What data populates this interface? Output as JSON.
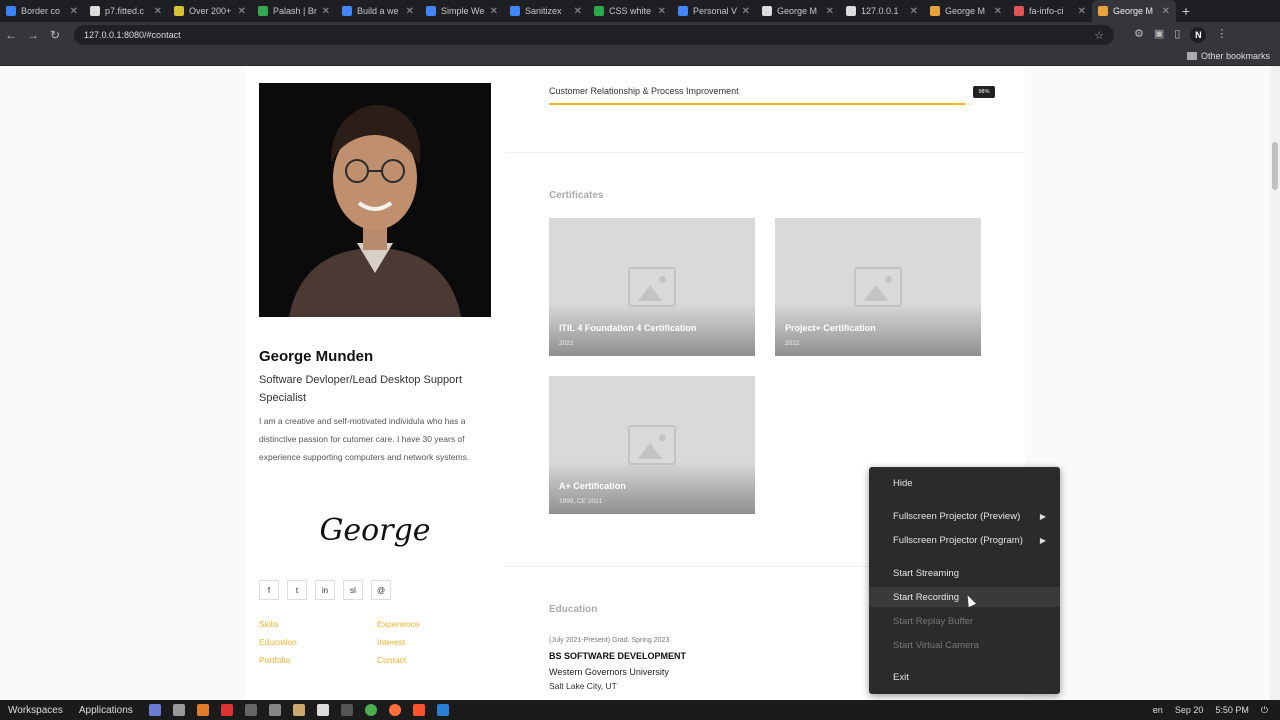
{
  "browser": {
    "tabs": [
      {
        "title": "Border co",
        "color": "#3b82f6"
      },
      {
        "title": "p7.fitted.c",
        "color": "#dddddd"
      },
      {
        "title": "Over 200+",
        "color": "#d4c13a"
      },
      {
        "title": "Palash | Br",
        "color": "#34a853"
      },
      {
        "title": "Build a we",
        "color": "#4285f4"
      },
      {
        "title": "Simple We",
        "color": "#4285f4"
      },
      {
        "title": "Sanitizex",
        "color": "#4285f4"
      },
      {
        "title": "CSS white",
        "color": "#2ba84a"
      },
      {
        "title": "Personal V",
        "color": "#4285f4"
      },
      {
        "title": "George M",
        "color": "#dddddd"
      },
      {
        "title": "127.0.0.1",
        "color": "#dddddd"
      },
      {
        "title": "George M",
        "color": "#e8a33d"
      },
      {
        "title": "fa-info-ci",
        "color": "#e25555"
      },
      {
        "title": "George M",
        "color": "#e8a33d",
        "active": true
      }
    ],
    "new_tab": "+",
    "url": "127.0.0.1:8080/#contact",
    "profile_initial": "N",
    "other_bookmarks": "Other bookmarks"
  },
  "profile": {
    "name": "George Munden",
    "role": "Software Devloper/Lead Desktop Support Specialist",
    "bio": "I am a creative and self-motivated individula who has a distinctive passion for cutomer care. I have 30 years of experience supporting computers and network systems.",
    "signature": "George",
    "socials": [
      "f",
      "t",
      "in",
      "sl",
      "@"
    ],
    "links": [
      "Skills",
      "Experience",
      "Education",
      "Interest",
      "Portfolio",
      "Contact"
    ]
  },
  "skill": {
    "label": "Customer Relationship & Process Improvement",
    "percent_label": "98%",
    "percent": 0.98
  },
  "certificates": {
    "title": "Certificates",
    "items": [
      {
        "name": "ITIL 4 Foundation 4 Certification",
        "year": "2022"
      },
      {
        "name": "Project+ Certification",
        "year": "2022"
      },
      {
        "name": "A+ Certification",
        "year": "1999, CE 2021"
      }
    ]
  },
  "education": {
    "title": "Education",
    "date": "(July 2021-Present) Grad. Spring 2023",
    "degree": "BS SOFTWARE DEVELOPMENT",
    "school": "Western Governors University",
    "location": "Salt Lake City, UT"
  },
  "context_menu": {
    "items": [
      {
        "label": "Hide",
        "disabled": false,
        "submenu": false
      },
      {
        "label": "Fullscreen Projector (Preview)",
        "disabled": false,
        "submenu": true
      },
      {
        "label": "Fullscreen Projector (Program)",
        "disabled": false,
        "submenu": true
      },
      {
        "label": "Start Streaming",
        "disabled": false,
        "submenu": false
      },
      {
        "label": "Start Recording",
        "disabled": false,
        "submenu": false,
        "hover": true
      },
      {
        "label": "Start Replay Buffer",
        "disabled": true,
        "submenu": false
      },
      {
        "label": "Start Virtual Camera",
        "disabled": true,
        "submenu": false
      },
      {
        "label": "Exit",
        "disabled": false,
        "submenu": false
      }
    ]
  },
  "taskbar": {
    "workspaces": "Workspaces",
    "applications": "Applications",
    "lang": "en",
    "date": "Sep 20",
    "time": "5:50 PM"
  }
}
